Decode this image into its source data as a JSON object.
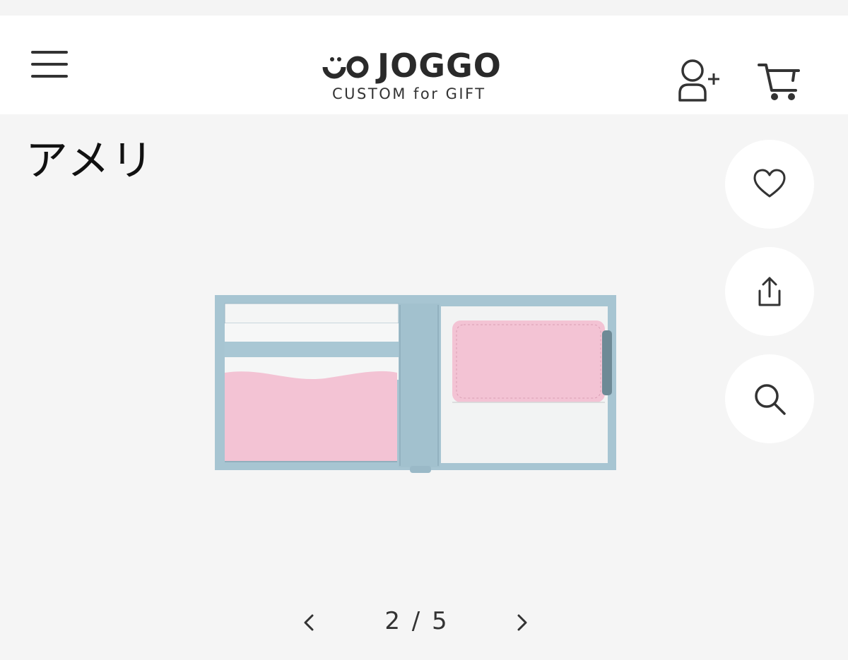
{
  "header": {
    "brand_name": "JOGGO",
    "brand_tagline": "CUSTOM for GIFT",
    "menu_icon": "hamburger-menu-icon",
    "account_icon": "user-add-icon",
    "cart_icon": "shopping-cart-icon"
  },
  "product": {
    "title": "アメリ",
    "image_alt": "wallet-image",
    "colors": {
      "body": "#a7c5d2",
      "pink": "#f3c3d4",
      "white": "#f5f6f6"
    }
  },
  "actions": {
    "favorite_icon": "heart-icon",
    "share_icon": "share-icon",
    "zoom_icon": "search-icon"
  },
  "pager": {
    "current": 2,
    "total": 5,
    "label": "2 / 5",
    "prev_icon": "chevron-left-icon",
    "next_icon": "chevron-right-icon"
  },
  "colors": {
    "background": "#f5f5f5",
    "header_bg": "#ffffff",
    "icon": "#333333"
  }
}
